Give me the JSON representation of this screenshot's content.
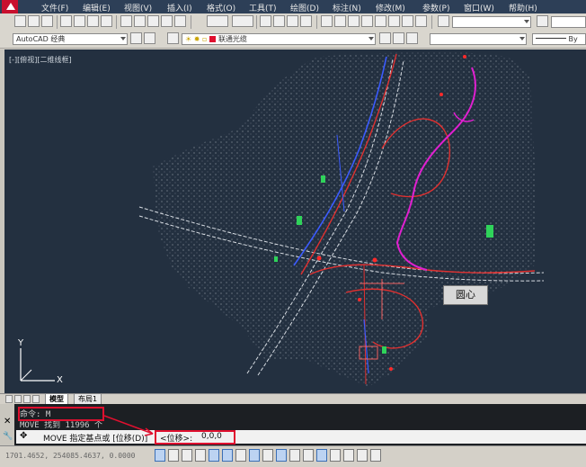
{
  "menu": [
    "文件(F)",
    "编辑(E)",
    "视图(V)",
    "插入(I)",
    "格式(O)",
    "工具(T)",
    "绘图(D)",
    "标注(N)",
    "修改(M)",
    "参数(P)",
    "窗口(W)",
    "帮助(H)"
  ],
  "workspace": {
    "name": "AutoCAD 经典"
  },
  "layer": {
    "name": "联通光缆"
  },
  "linetype": {
    "name": "By"
  },
  "viewport": {
    "label": "[-][俯视][二维线框]"
  },
  "tooltip": {
    "text": "圆心"
  },
  "ucs": {
    "x_label": "X",
    "y_label": "Y"
  },
  "tabs": [
    {
      "label": "模型",
      "active": true
    },
    {
      "label": "布局1",
      "active": false
    }
  ],
  "command": {
    "history_1": "命令: M",
    "history_2": "MOVE 找到 11996 个",
    "prompt": "MOVE 指定基点或 [位移(D)]",
    "input_label": "<位移>:",
    "input_value": "0,0,0"
  },
  "status": {
    "coords": "1701.4652, 254085.4637, 0.0000"
  },
  "colors": {
    "background": "#233040",
    "highlight": "#e0102f",
    "road_red": "#e03030",
    "road_blue": "#3b5bff",
    "magenta": "#e020d0",
    "green": "#2fd35a"
  }
}
